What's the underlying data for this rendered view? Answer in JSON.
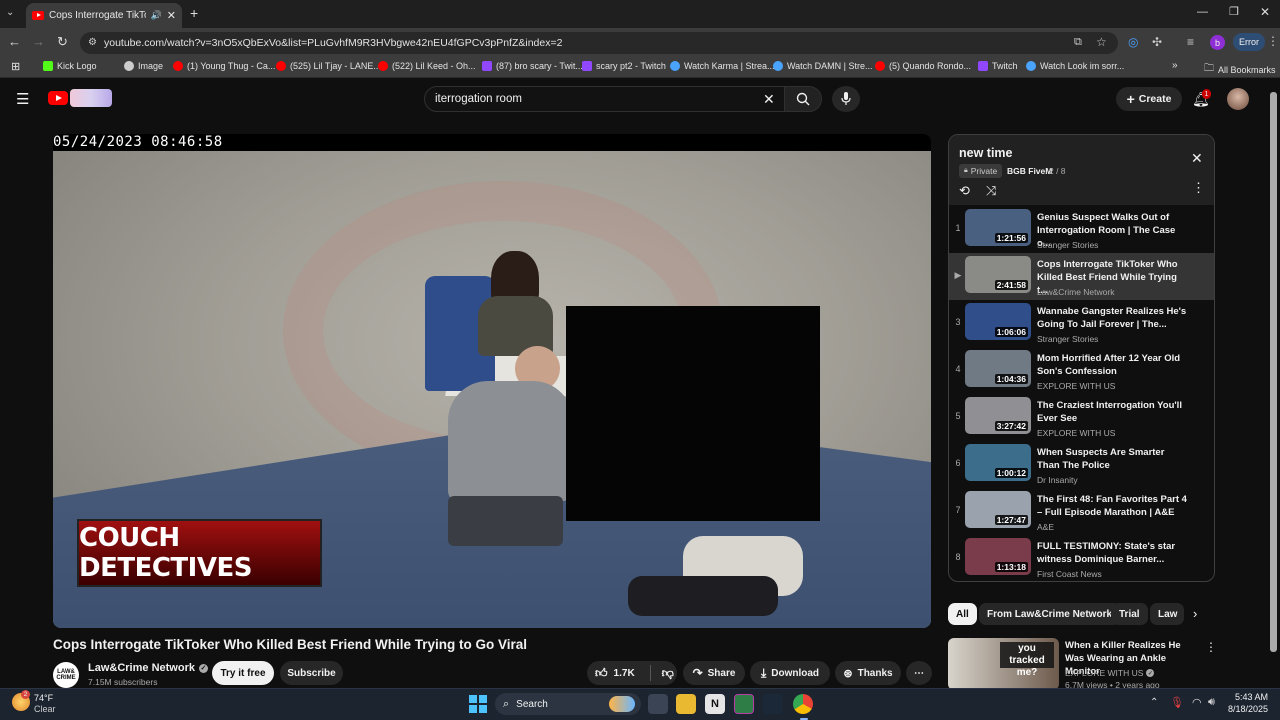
{
  "browser": {
    "tab_title": "Cops Interrogate TikToker W",
    "url": "youtube.com/watch?v=3nO5xQbExVo&list=PLuGvhfM9R3HVbgwe42nEU4fGPCv3pPnfZ&index=2",
    "profile_badge": "b",
    "error_label": "Error",
    "bookmarks": [
      {
        "label": "Kick Logo",
        "color": "#53fc18"
      },
      {
        "label": "Image",
        "color": "#cccccc"
      },
      {
        "label": "(1) Young Thug - Ca...",
        "color": "#ff0000"
      },
      {
        "label": "(525) Lil Tjay - LANE...",
        "color": "#ff0000"
      },
      {
        "label": "(522) Lil Keed - Oh...",
        "color": "#ff0000"
      },
      {
        "label": "(87) bro scary - Twit...",
        "color": "#9146ff"
      },
      {
        "label": "scary pt2 - Twitch",
        "color": "#9146ff"
      },
      {
        "label": "Watch Karma | Strea...",
        "color": "#4aa3ff"
      },
      {
        "label": "Watch DAMN | Stre...",
        "color": "#4aa3ff"
      },
      {
        "label": "(5) Quando Rondo...",
        "color": "#ff0000"
      },
      {
        "label": "Twitch",
        "color": "#9146ff"
      },
      {
        "label": "Watch Look im sorr...",
        "color": "#4aa3ff"
      }
    ],
    "all_bookmarks": "All Bookmarks"
  },
  "header": {
    "search_value": "iterrogation room",
    "create_label": "Create",
    "notification_count": "1"
  },
  "player": {
    "timestamp": "05/24/2023 08:46:58",
    "watermark": "COUCH DETECTIVES"
  },
  "video": {
    "title": "Cops Interrogate TikToker Who Killed Best Friend While Trying to Go Viral",
    "channel": "Law&Crime Network",
    "channel_avatar": "LAW& CRIME",
    "subscribers": "7.15M subscribers",
    "try_label": "Try it free",
    "subscribe_label": "Subscribe",
    "likes": "1.7K",
    "share_label": "Share",
    "download_label": "Download",
    "thanks_label": "Thanks"
  },
  "playlist": {
    "title": "new time",
    "privacy": "Private",
    "owner": "BGB FiveM",
    "position": "2 / 8",
    "items": [
      {
        "index": "1",
        "title": "Genius Suspect Walks Out of Interrogation Room | The Case o...",
        "channel": "Stranger Stories",
        "duration": "1:21:56",
        "thumb": "#4a6080"
      },
      {
        "index": "▶",
        "title": "Cops Interrogate TikToker Who Killed Best Friend While Trying t...",
        "channel": "Law&Crime Network",
        "duration": "2:41:58",
        "thumb": "#8a8a86"
      },
      {
        "index": "3",
        "title": "Wannabe Gangster Realizes He's Going To Jail Forever | The...",
        "channel": "Stranger Stories",
        "duration": "1:06:06",
        "thumb": "#2f4e8a"
      },
      {
        "index": "4",
        "title": "Mom Horrified After 12 Year Old Son's Confession",
        "channel": "EXPLORE WITH US",
        "duration": "1:04:36",
        "thumb": "#6f7a84"
      },
      {
        "index": "5",
        "title": "The Craziest Interrogation You'll Ever See",
        "channel": "EXPLORE WITH US",
        "duration": "3:27:42",
        "thumb": "#8f8f94"
      },
      {
        "index": "6",
        "title": "When Suspects Are Smarter Than The Police",
        "channel": "Dr Insanity",
        "duration": "1:00:12",
        "thumb": "#3c6e8c"
      },
      {
        "index": "7",
        "title": "The First 48: Fan Favorites Part 4 – Full Episode Marathon | A&E",
        "channel": "A&E",
        "duration": "1:27:47",
        "thumb": "#9aa3ad"
      },
      {
        "index": "8",
        "title": "FULL TESTIMONY: State's star witness Dominique Barner...",
        "channel": "First Coast News",
        "duration": "1:13:18",
        "thumb": "#7a3b4a"
      }
    ]
  },
  "chips": [
    "All",
    "From Law&Crime Network",
    "Trial",
    "Law"
  ],
  "recommended": {
    "title": "When a Killer Realizes He Was Wearing an Ankle Monitor",
    "thumb_text": "you tracked me?",
    "channel": "EXPLORE WITH US",
    "meta": "6.7M views • 2 years ago"
  },
  "taskbar": {
    "temp": "74°F",
    "weather": "Clear",
    "weather_badge": "2",
    "search_label": "Search",
    "time": "5:43 AM",
    "date": "8/18/2025"
  }
}
